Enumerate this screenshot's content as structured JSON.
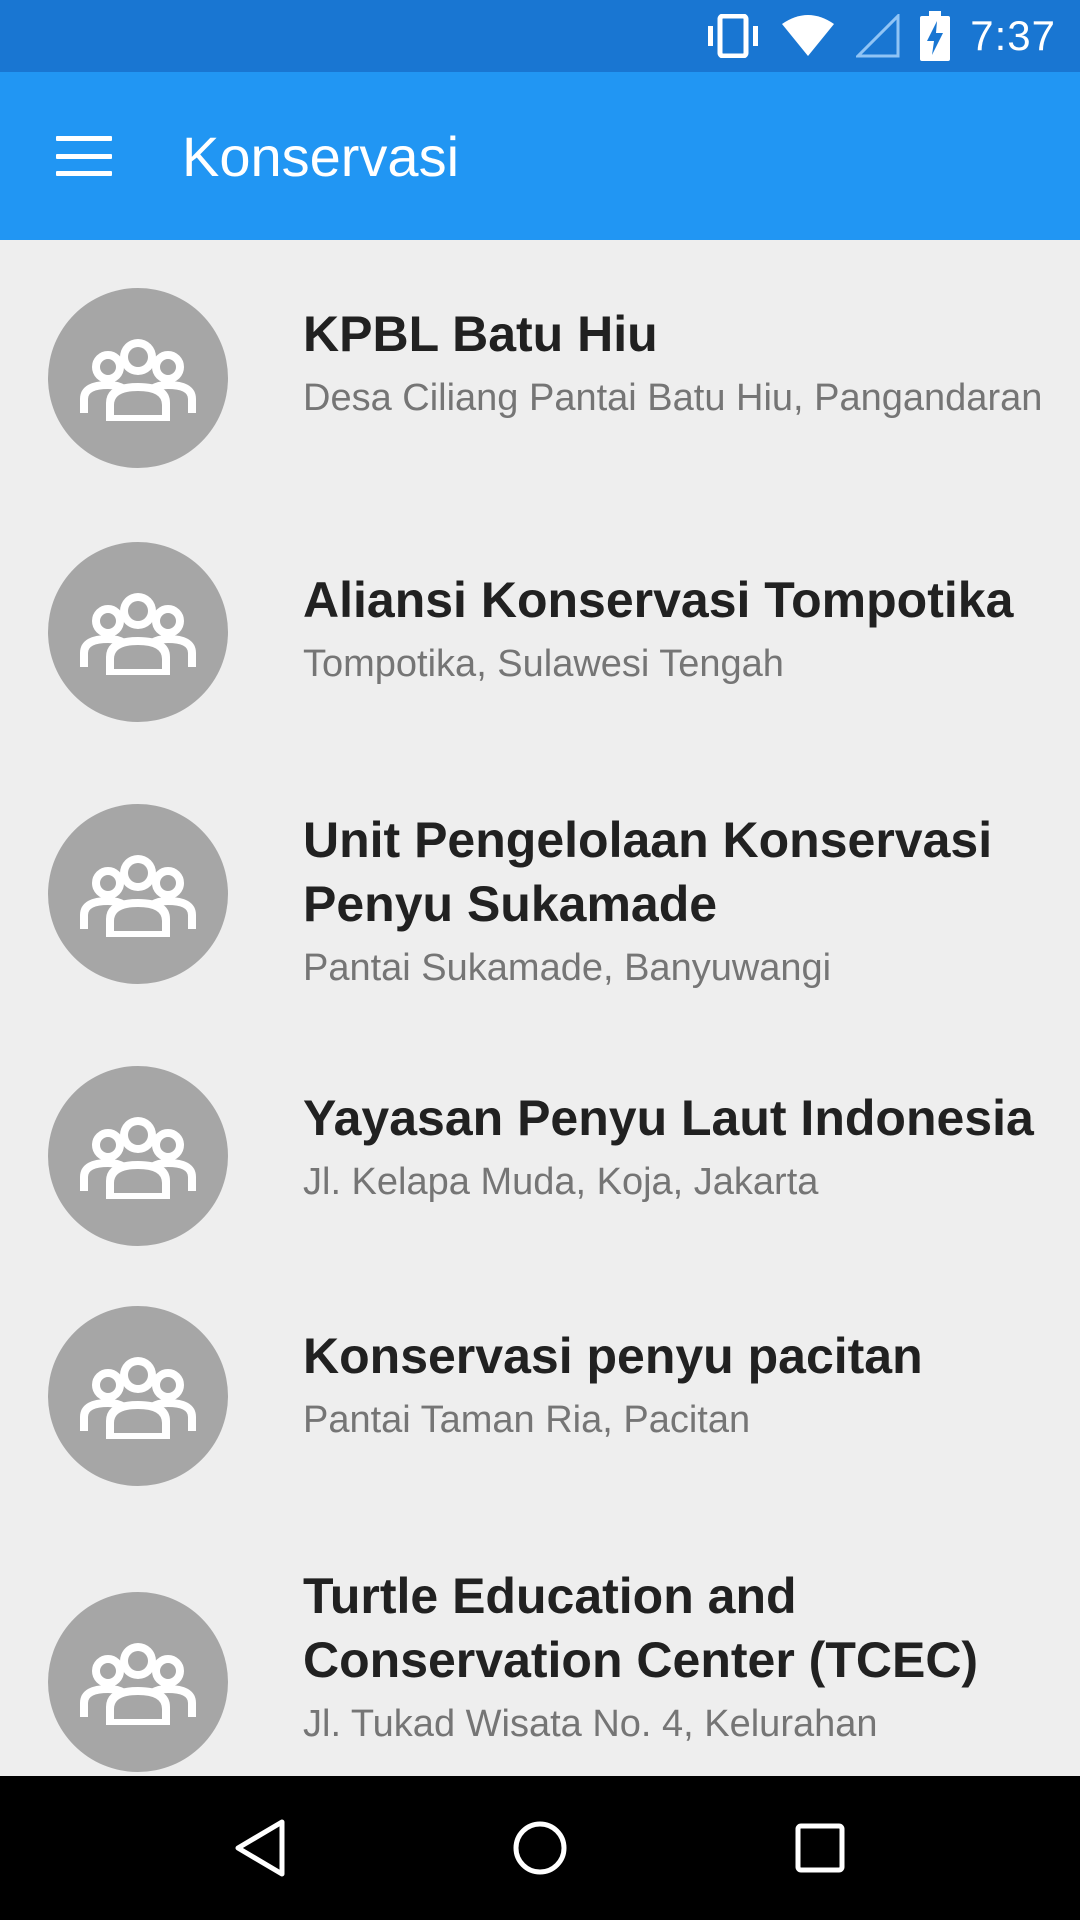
{
  "status_bar": {
    "time": "7:37",
    "icons": [
      "vibrate-icon",
      "wifi-icon",
      "signal-icon",
      "battery-charging-icon"
    ]
  },
  "app_bar": {
    "menu_icon": "menu-icon",
    "title": "Konservasi"
  },
  "list": {
    "items": [
      {
        "title": "KPBL Batu Hiu",
        "subtitle": "Desa Ciliang Pantai Batu Hiu, Pangandaran",
        "icon": "group-icon"
      },
      {
        "title": "Aliansi Konservasi Tompotika",
        "subtitle": "Tompotika, Sulawesi Tengah",
        "icon": "group-icon"
      },
      {
        "title": "Unit Pengelolaan Konservasi Penyu Sukamade",
        "subtitle": "Pantai Sukamade, Banyuwangi",
        "icon": "group-icon"
      },
      {
        "title": "Yayasan Penyu Laut Indonesia",
        "subtitle": "Jl. Kelapa Muda, Koja, Jakarta",
        "icon": "group-icon"
      },
      {
        "title": "Konservasi penyu pacitan",
        "subtitle": "Pantai Taman Ria, Pacitan",
        "icon": "group-icon"
      },
      {
        "title": "Turtle Education and Conservation Center (TCEC)",
        "subtitle": "Jl. Tukad Wisata No. 4, Kelurahan",
        "icon": "group-icon"
      }
    ]
  },
  "nav_bar": {
    "buttons": [
      "back-icon",
      "home-icon",
      "recents-icon"
    ]
  },
  "colors": {
    "status_bar": "#1976d2",
    "app_bar": "#2196f3",
    "background": "#eeeeee",
    "avatar": "#a6a6a6"
  }
}
